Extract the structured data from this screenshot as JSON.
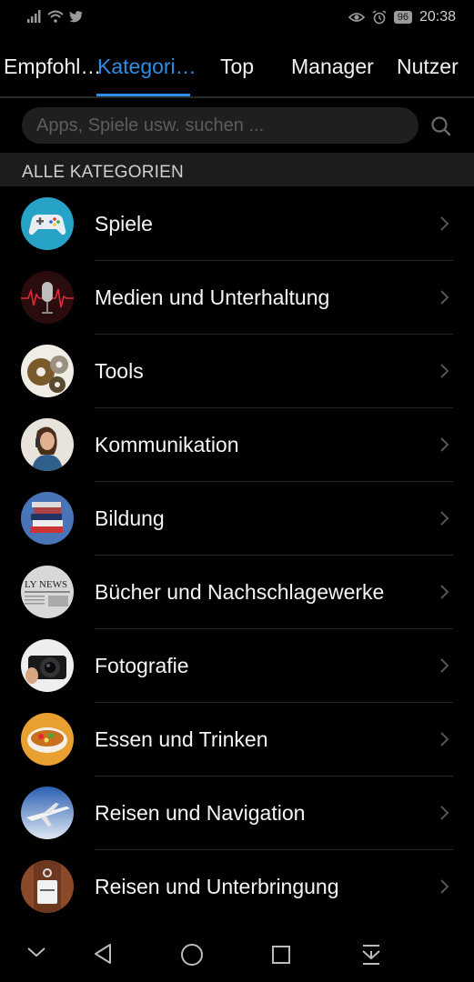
{
  "status_bar": {
    "time": "20:38",
    "battery": "96",
    "icons": [
      "signal-icon",
      "wifi-icon",
      "twitter-icon",
      "eye-icon",
      "alarm-icon",
      "battery-icon"
    ]
  },
  "tabs": [
    {
      "label": "Empfohl…",
      "active": false
    },
    {
      "label": "Kategori…",
      "active": true
    },
    {
      "label": "Top",
      "active": false
    },
    {
      "label": "Manager",
      "active": false
    },
    {
      "label": "Nutzer",
      "active": false
    }
  ],
  "search": {
    "placeholder": "Apps, Spiele usw. suchen ...",
    "value": ""
  },
  "section": {
    "title": "ALLE KATEGORIEN"
  },
  "categories": [
    {
      "label": "Spiele",
      "icon": "gamepad-icon"
    },
    {
      "label": "Medien und Unterhaltung",
      "icon": "microphone-icon"
    },
    {
      "label": "Tools",
      "icon": "gears-icon"
    },
    {
      "label": "Kommunikation",
      "icon": "person-phone-icon"
    },
    {
      "label": "Bildung",
      "icon": "books-icon"
    },
    {
      "label": "Bücher und Nachschlagewerke",
      "icon": "newspaper-icon"
    },
    {
      "label": "Fotografie",
      "icon": "camera-icon"
    },
    {
      "label": "Essen und Trinken",
      "icon": "food-bowl-icon"
    },
    {
      "label": "Reisen und Navigation",
      "icon": "airplane-icon"
    },
    {
      "label": "Reisen und Unterbringung",
      "icon": "door-sign-icon"
    }
  ],
  "colors": {
    "accent": "#2c8fe6",
    "background": "#000000",
    "section_header_bg": "#1c1c1c"
  },
  "nav_bar": {
    "icons": [
      "collapse-icon",
      "back-icon",
      "home-icon",
      "recents-icon",
      "notification-pull-icon"
    ]
  }
}
